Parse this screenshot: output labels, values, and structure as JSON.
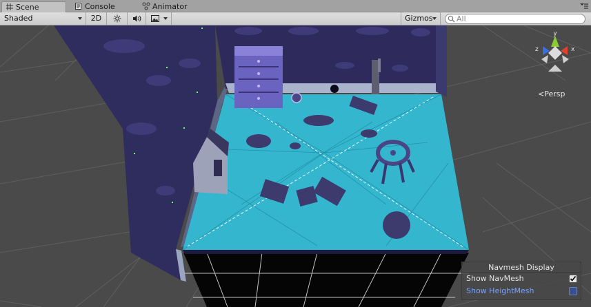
{
  "tabs": [
    {
      "label": "Scene",
      "icon": "scene-icon"
    },
    {
      "label": "Console",
      "icon": "console-icon"
    },
    {
      "label": "Animator",
      "icon": "animator-icon"
    }
  ],
  "toolbar": {
    "draw_mode": "Shaded",
    "mode_2d": "2D",
    "lighting_icon": "sun-icon",
    "audio_icon": "speaker-icon",
    "effects_icon": "image-icon",
    "gizmos_label": "Gizmos",
    "search_placeholder": "All"
  },
  "scene": {
    "projection_label": "Persp",
    "axis_labels": {
      "x": "x",
      "y": "y",
      "z": "z"
    }
  },
  "navmesh_display": {
    "title": "Navmesh Display",
    "show_navmesh_label": "Show NavMesh",
    "show_navmesh_checked": true,
    "show_heightmesh_label": "Show HeightMesh",
    "show_heightmesh_checked": false
  },
  "colors": {
    "navmesh": "#35b6cf",
    "wall": "#2e2b5c",
    "grid": "#5e5e5e",
    "axis_x": "#e0432c",
    "axis_y": "#8acc32",
    "axis_z": "#3b6fe0"
  }
}
